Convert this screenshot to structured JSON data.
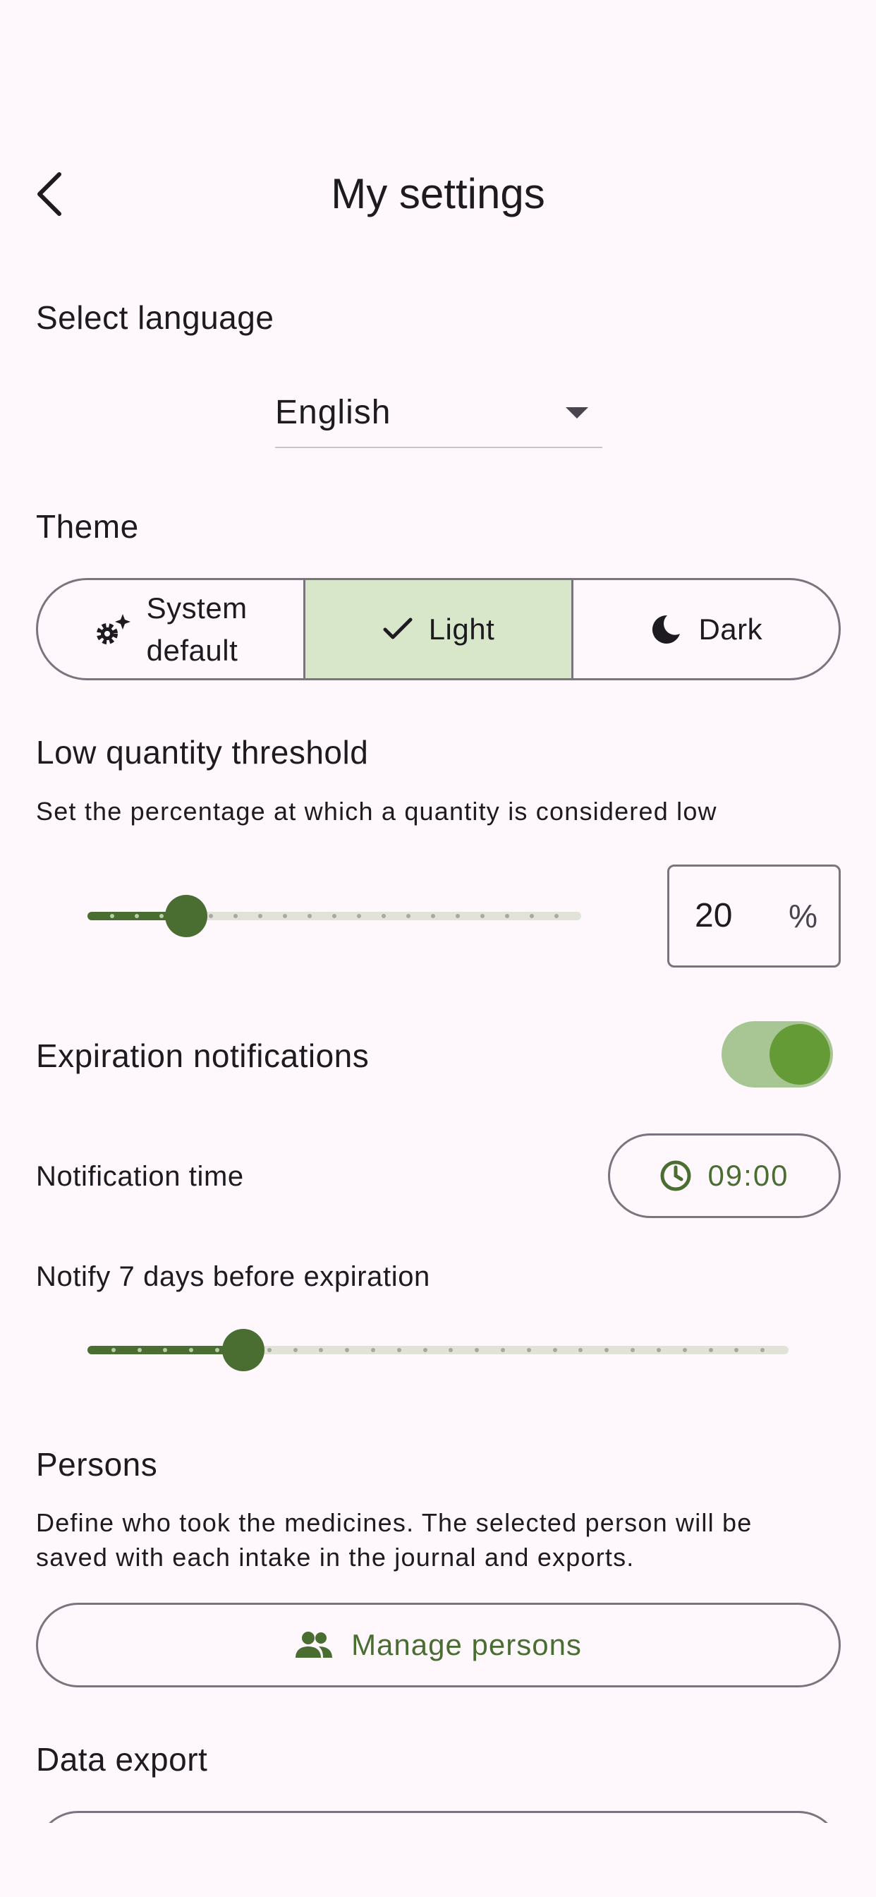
{
  "header": {
    "title": "My settings"
  },
  "language": {
    "section_title": "Select language",
    "selected": "English"
  },
  "theme": {
    "section_title": "Theme",
    "options": [
      {
        "line1": "System",
        "line2": "default",
        "icon": "gear-sparkle-icon"
      },
      {
        "label": "Light",
        "icon": "check-icon",
        "selected": true
      },
      {
        "label": "Dark",
        "icon": "moon-icon"
      }
    ]
  },
  "low_quantity": {
    "section_title": "Low quantity threshold",
    "description": "Set the percentage at which a quantity is considered low",
    "value": "20",
    "suffix": "%",
    "slider_fraction": 0.2,
    "slider_steps": 20
  },
  "expiration": {
    "section_title": "Expiration notifications",
    "enabled": true,
    "notification_time_label": "Notification time",
    "notification_time": "09:00",
    "notify_days_label": "Notify 7 days before expiration",
    "slider_fraction": 0.222,
    "slider_steps": 27
  },
  "persons": {
    "section_title": "Persons",
    "description_line1": "Define who took the medicines. The selected person will be",
    "description_line2": "saved with each intake in the journal and exports.",
    "manage_label": "Manage persons"
  },
  "data_export": {
    "section_title": "Data export"
  },
  "colors": {
    "background": "#fef7fc",
    "primary": "#4a6d32",
    "selected_segment": "#d8e7c9",
    "switch_track": "#a8c594",
    "switch_thumb": "#649b36",
    "outline": "#79747e"
  }
}
